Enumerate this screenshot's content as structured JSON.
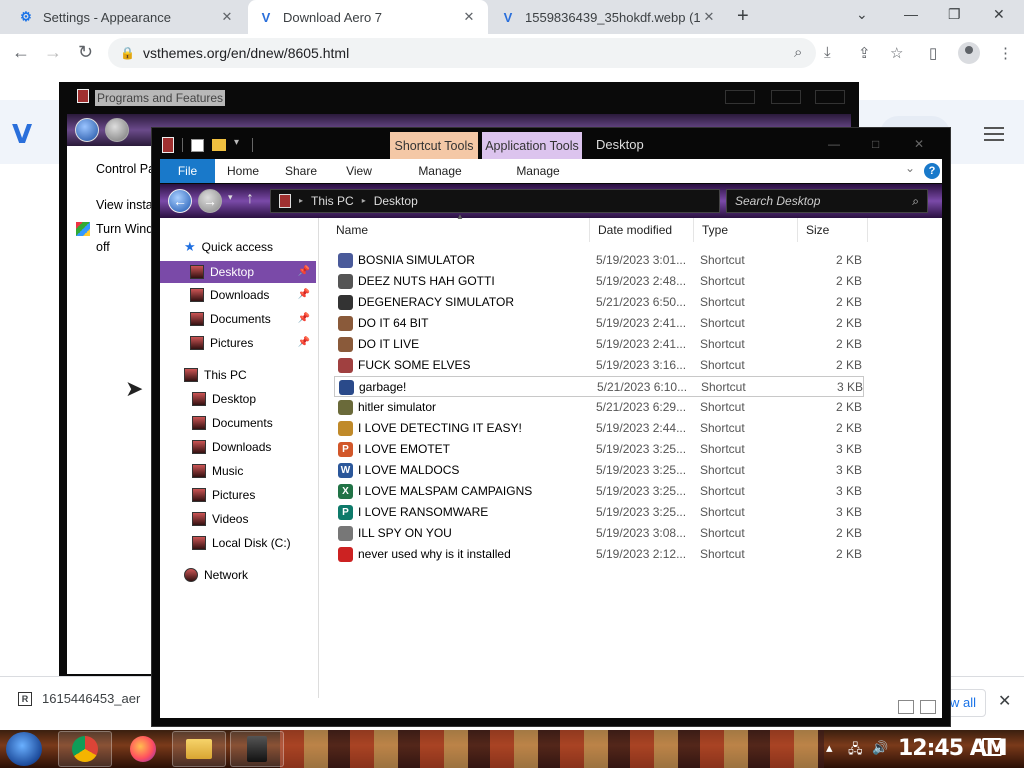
{
  "browser": {
    "tabs": [
      {
        "title": "Settings - Appearance",
        "icon": "gear-icon",
        "active": false
      },
      {
        "title": "Download Aero 7",
        "icon": "vsthemes-icon",
        "active": true
      },
      {
        "title": "1559836439_35hokdf.webp (1(",
        "icon": "vsthemes-icon",
        "active": false
      }
    ],
    "url": "vsthemes.org/en/dnew/8605.html",
    "download": {
      "filename": "1615446453_aer",
      "show_all": "w all"
    }
  },
  "programs_window": {
    "title": "Programs and Features",
    "links": [
      "Control Pa",
      "View insta",
      "Turn Wind",
      "off"
    ]
  },
  "explorer": {
    "contextual_tabs": {
      "shortcut": "Shortcut Tools",
      "application": "Application Tools"
    },
    "title": "Desktop",
    "ribbon_tabs": [
      "File",
      "Home",
      "Share",
      "View",
      "Manage",
      "Manage"
    ],
    "breadcrumb": [
      "This PC",
      "Desktop"
    ],
    "search_placeholder": "Search Desktop",
    "nav": {
      "quick_access": "Quick access",
      "quick_items": [
        "Desktop",
        "Downloads",
        "Documents",
        "Pictures"
      ],
      "this_pc": "This PC",
      "pc_items": [
        "Desktop",
        "Documents",
        "Downloads",
        "Music",
        "Pictures",
        "Videos",
        "Local Disk (C:)"
      ],
      "network": "Network"
    },
    "columns": [
      "Name",
      "Date modified",
      "Type",
      "Size"
    ],
    "files": [
      {
        "name": "BOSNIA SIMULATOR",
        "date": "5/19/2023 3:01...",
        "type": "Shortcut",
        "size": "2 KB",
        "color": "#4a5a9a"
      },
      {
        "name": "DEEZ NUTS HAH GOTTI",
        "date": "5/19/2023 2:48...",
        "type": "Shortcut",
        "size": "2 KB",
        "color": "#555555"
      },
      {
        "name": "DEGENERACY SIMULATOR",
        "date": "5/21/2023 6:50...",
        "type": "Shortcut",
        "size": "2 KB",
        "color": "#333333"
      },
      {
        "name": "DO IT 64 BIT",
        "date": "5/19/2023 2:41...",
        "type": "Shortcut",
        "size": "2 KB",
        "color": "#8a5a3a"
      },
      {
        "name": "DO IT LIVE",
        "date": "5/19/2023 2:41...",
        "type": "Shortcut",
        "size": "2 KB",
        "color": "#8a5a3a"
      },
      {
        "name": "FUCK SOME ELVES",
        "date": "5/19/2023 3:16...",
        "type": "Shortcut",
        "size": "2 KB",
        "color": "#a04040"
      },
      {
        "name": "garbage!",
        "date": "5/21/2023 6:10...",
        "type": "Shortcut",
        "size": "3 KB",
        "color": "#2a4a8a"
      },
      {
        "name": "hitler simulator",
        "date": "5/21/2023 6:29...",
        "type": "Shortcut",
        "size": "2 KB",
        "color": "#6a6a3a"
      },
      {
        "name": "I LOVE DETECTING IT EASY!",
        "date": "5/19/2023 2:44...",
        "type": "Shortcut",
        "size": "2 KB",
        "color": "#c08a2a"
      },
      {
        "name": "I LOVE EMOTET",
        "date": "5/19/2023 3:25...",
        "type": "Shortcut",
        "size": "3 KB",
        "color": "#d2572a"
      },
      {
        "name": "I LOVE MALDOCS",
        "date": "5/19/2023 3:25...",
        "type": "Shortcut",
        "size": "3 KB",
        "color": "#2b579a"
      },
      {
        "name": "I LOVE MALSPAM CAMPAIGNS",
        "date": "5/19/2023 3:25...",
        "type": "Shortcut",
        "size": "3 KB",
        "color": "#217346"
      },
      {
        "name": "I LOVE RANSOMWARE",
        "date": "5/19/2023 3:25...",
        "type": "Shortcut",
        "size": "3 KB",
        "color": "#0e7a6a"
      },
      {
        "name": "ILL SPY ON YOU",
        "date": "5/19/2023 3:08...",
        "type": "Shortcut",
        "size": "2 KB",
        "color": "#777777"
      },
      {
        "name": "never used why is it installed",
        "date": "5/19/2023 2:12...",
        "type": "Shortcut",
        "size": "2 KB",
        "color": "#cc2222"
      }
    ],
    "icon_letters": [
      "",
      "",
      "",
      "",
      "",
      "",
      "",
      "",
      "",
      "P",
      "W",
      "X",
      "P",
      "",
      ""
    ]
  },
  "taskbar": {
    "clock": "12:45 AM"
  }
}
